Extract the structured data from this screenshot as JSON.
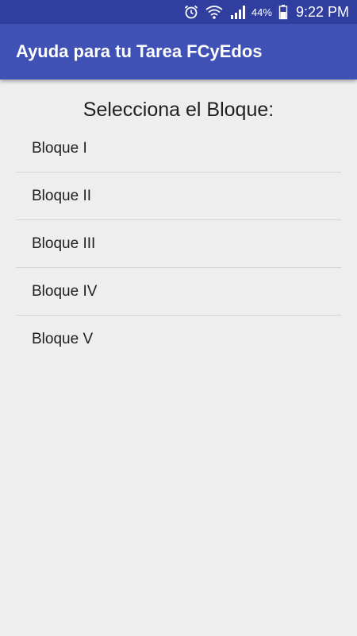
{
  "status_bar": {
    "alarm_icon": "alarm-clock-icon",
    "wifi_icon": "wifi-icon",
    "signal_icon": "cell-signal-icon",
    "battery_percent": "44%",
    "battery_icon": "battery-icon",
    "time": "9:22 PM"
  },
  "app_bar": {
    "title": "Ayuda para tu Tarea FCyEdos",
    "color": "#3f51b5",
    "status_color": "#303f9f"
  },
  "main": {
    "heading": "Selecciona el Bloque:",
    "items": [
      {
        "label": "Bloque I"
      },
      {
        "label": "Bloque II"
      },
      {
        "label": "Bloque III"
      },
      {
        "label": "Bloque IV"
      },
      {
        "label": "Bloque V"
      }
    ]
  }
}
